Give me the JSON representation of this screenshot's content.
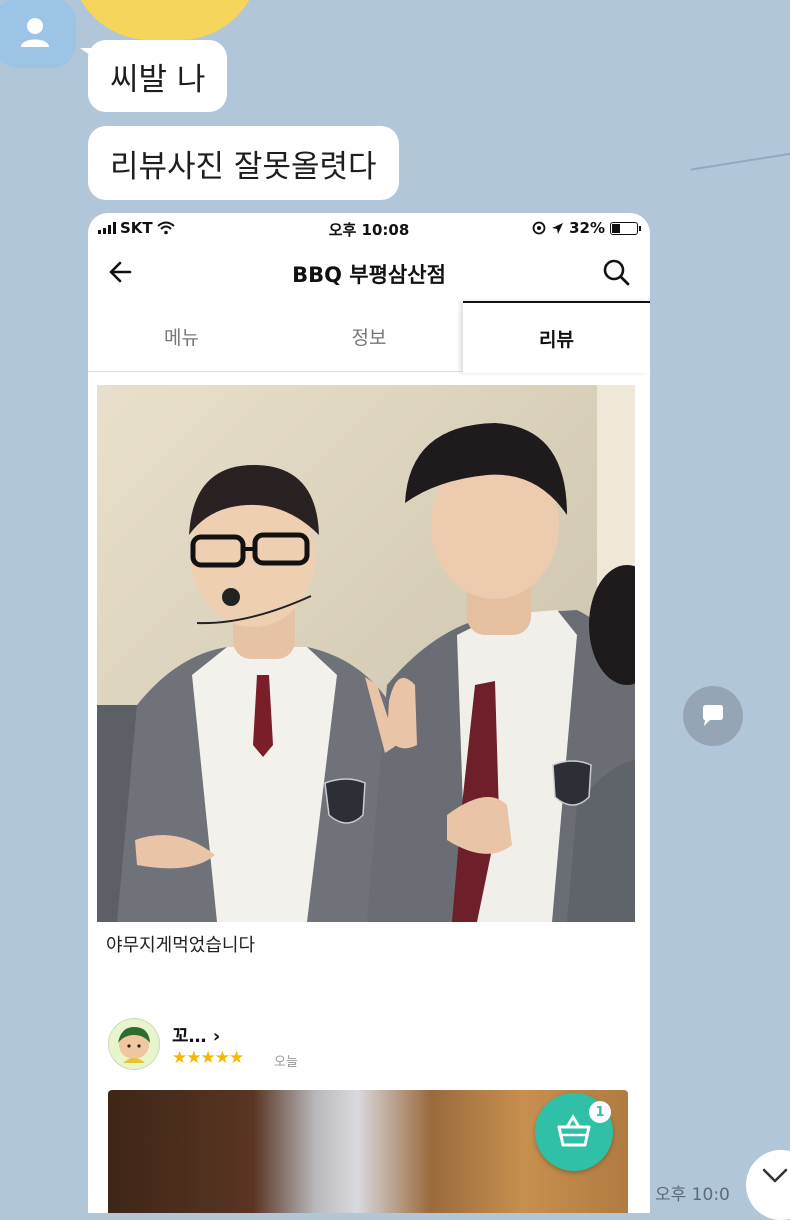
{
  "chat": {
    "messages": [
      {
        "text": "씨발 나"
      },
      {
        "text": "리뷰사진 잘못올렷다"
      }
    ],
    "timestamp": "오후 10:0"
  },
  "phone": {
    "status": {
      "carrier": "SKT",
      "time": "오후 10:08",
      "battery": "32%"
    },
    "nav": {
      "title": "BBQ 부평삼산점"
    },
    "tabs": [
      {
        "label": "메뉴"
      },
      {
        "label": "정보"
      },
      {
        "label": "리뷰",
        "selected": true
      }
    ],
    "review": {
      "text": "야무지게먹었습니다"
    },
    "next_review": {
      "name": "꼬…",
      "stars": "★★★★★",
      "rating": 5,
      "date": "오늘"
    },
    "cart": {
      "count": "1"
    }
  },
  "colors": {
    "chat_background": "#b2c6da",
    "accent": "#2fc0a7",
    "star": "#f5b800"
  },
  "icons": [
    "back-arrow-icon",
    "search-icon",
    "wifi-icon",
    "location-icon",
    "cart-icon",
    "share-icon",
    "chevron-down-icon"
  ]
}
